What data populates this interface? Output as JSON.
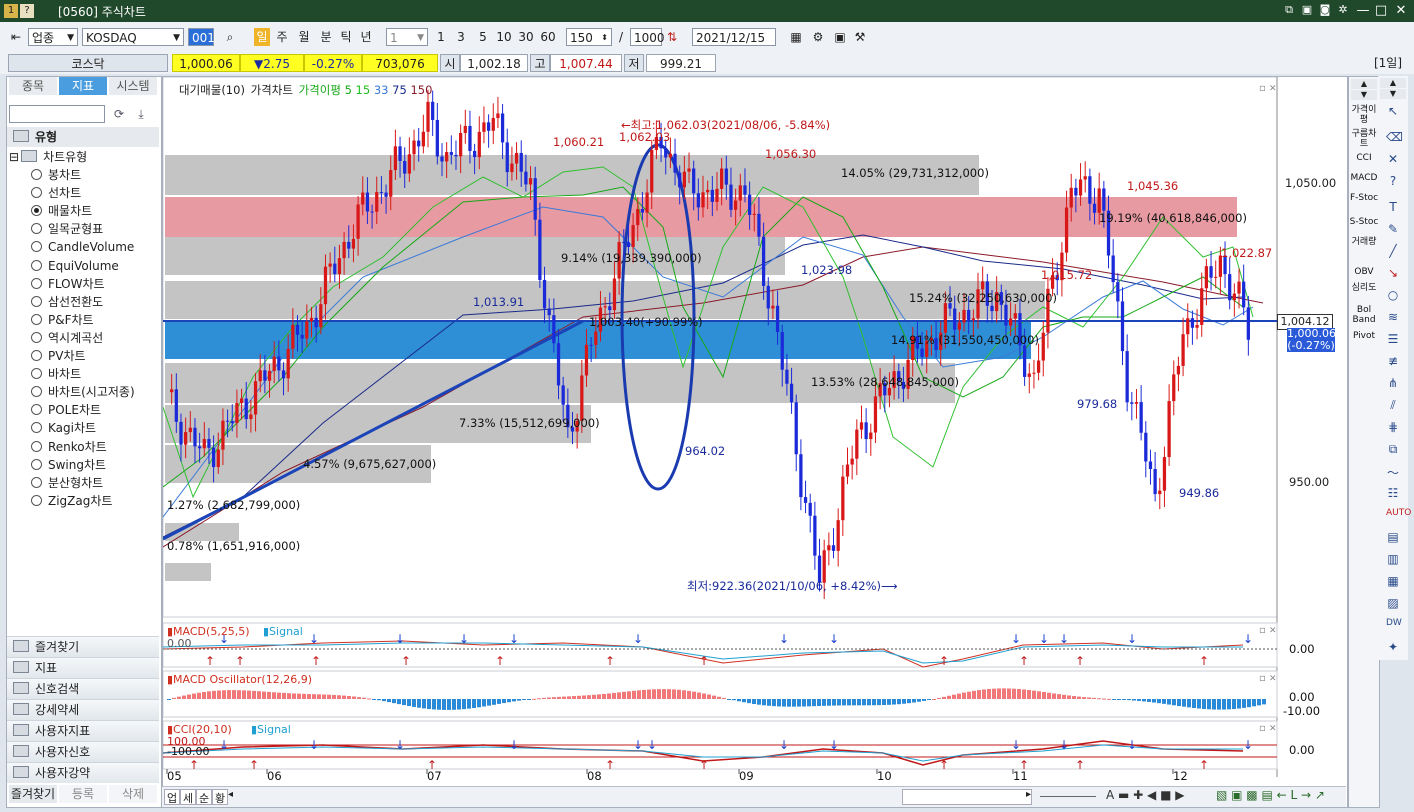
{
  "window": {
    "title": "[0560] 주식차트",
    "icons": [
      "restore-icon",
      "window-icon",
      "camera-icon",
      "gear-icon"
    ],
    "buttons": [
      "—",
      "□",
      "✕"
    ]
  },
  "toolbar": {
    "market": "업종",
    "index": "KOSDAQ",
    "periods": [
      "일",
      "주",
      "월",
      "분",
      "틱",
      "년"
    ],
    "selected_period": "일",
    "interval": "1",
    "quick": [
      "1",
      "3",
      "5",
      "10",
      "30",
      "60"
    ],
    "count": "150",
    "total": "1000",
    "date": "2021/12/15"
  },
  "pricebar": {
    "name": "코스닥",
    "price": "1,000.06",
    "change": "▼2.75",
    "pct": "-0.27%",
    "volume": "703,076",
    "open_label": "시",
    "open": "1,002.18",
    "high_label": "고",
    "high": "1,007.44",
    "low_label": "저",
    "low": "999.21",
    "period_label": "[1일]"
  },
  "left": {
    "tabs": [
      "종목",
      "지표",
      "시스템"
    ],
    "selected_tab": "지표",
    "section": "유형",
    "subsection": "차트유형",
    "chart_types": [
      "봉차트",
      "선차트",
      "매물차트",
      "일목균형표",
      "CandleVolume",
      "EquiVolume",
      "FLOW차트",
      "삼선전환도",
      "P&F차트",
      "역시계곡선",
      "PV차트",
      "바차트",
      "바차트(시고저종)",
      "POLE차트",
      "Kagi차트",
      "Renko차트",
      "Swing차트",
      "분산형차트",
      "ZigZag차트"
    ],
    "selected_type": "매물차트",
    "folders": [
      "즐겨찾기",
      "지표",
      "신호검색",
      "강세약세",
      "사용자지표",
      "사용자신호",
      "사용자강약"
    ],
    "bottom_tabs": [
      "즐겨찾기",
      "등록",
      "삭제"
    ]
  },
  "legend": {
    "items": [
      "대기매물(10)",
      "가격차트",
      "가격이평",
      "5",
      "15",
      "33",
      "75",
      "150"
    ],
    "colors": [
      "#000000",
      "#000000",
      "#18a818",
      "#18a818",
      "#20c020",
      "#3a7ad8",
      "#1a2a8a",
      "#8a1a2a"
    ]
  },
  "annotations": {
    "high": "←최고:1,062.03(2021/08/06, -5.84%)",
    "low": "최저:922.36(2021/10/06, +8.42%)⟶",
    "labels_red": [
      "1,060.21",
      "1,062.03",
      "1,056.30",
      "1,045.36",
      "1,022.87",
      "1,015.72"
    ],
    "labels_blue": [
      "1,013.91",
      "1,023.98",
      "964.02",
      "979.68",
      "949.86"
    ],
    "profile": [
      "14.05% (29,731,312,000)",
      "19.19% (40,618,846,000)",
      "9.14% (19,339,390,000)",
      "15.24% (32,250,630,000)",
      "1,003.40(+90.99%)",
      "14.91% (31,550,450,000)",
      "13.53% (28,648,845,000)",
      "7.33% (15,512,699,000)",
      "4.57% (9,675,627,000)",
      "1.27% (2,682,799,000)",
      "0.78% (1,651,916,000)"
    ]
  },
  "axis": {
    "y_labels": [
      "1,050.00",
      "950.00"
    ],
    "current": "1,004.12",
    "current2": "1,000.06",
    "current3": "(-0.27%)",
    "x_labels": [
      "05",
      "06",
      "07",
      "08",
      "09",
      "10",
      "11",
      "12"
    ]
  },
  "panels": {
    "macd": {
      "title": "MACD(5,25,5)",
      "signal": "Signal",
      "left_value": "0.00",
      "axis": "0.00"
    },
    "osc": {
      "title": "MACD Oscillator(12,26,9)",
      "axis": [
        "0.00",
        "-10.00"
      ]
    },
    "cci": {
      "title": "CCI(20,10)",
      "signal": "Signal",
      "left_top": "100.00",
      "left_bot": "-100.00",
      "axis": "0.00"
    }
  },
  "rightbar": {
    "labels": [
      "가격이평",
      "구름차트",
      "CCI",
      "MACD",
      "F-Stoc",
      "S-Stoc",
      "거래량",
      "OBV",
      "심리도",
      "Bol Band",
      "Pivot"
    ]
  },
  "bottom": {
    "tabs": [
      "업",
      "세",
      "순",
      "황"
    ]
  },
  "chart_data": {
    "type": "candlestick",
    "ylim": [
      915,
      1070
    ],
    "x_months": [
      "05",
      "06",
      "07",
      "08",
      "09",
      "10",
      "11",
      "12"
    ],
    "volume_profile_pct": [
      0.78,
      1.27,
      4.57,
      7.33,
      13.53,
      14.91,
      15.24,
      9.14,
      19.19,
      14.05
    ]
  }
}
